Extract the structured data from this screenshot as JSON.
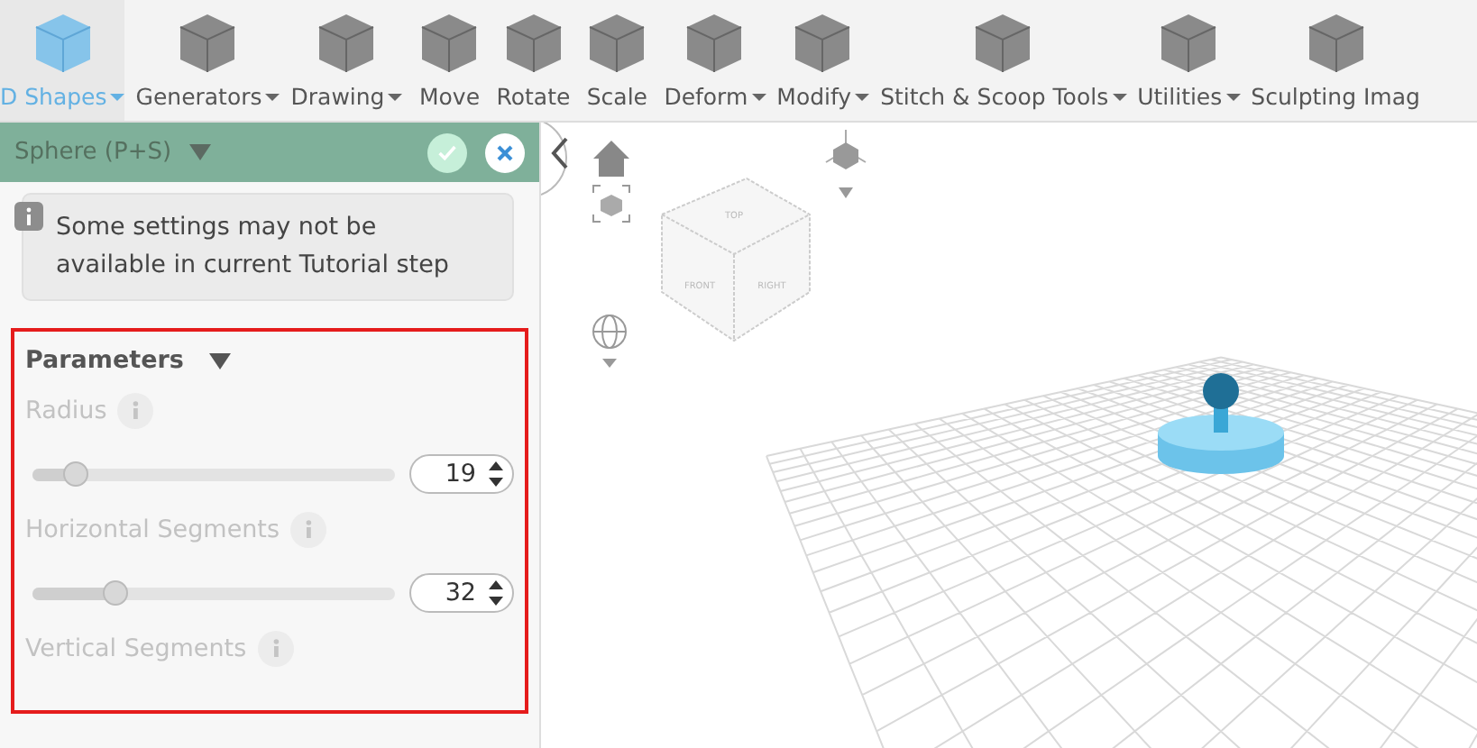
{
  "toolbar": {
    "items": [
      {
        "label": "D Shapes",
        "dropdown": true,
        "selected": true
      },
      {
        "label": "Generators",
        "dropdown": true,
        "selected": false
      },
      {
        "label": "Drawing",
        "dropdown": true,
        "selected": false
      },
      {
        "label": "Move",
        "dropdown": false,
        "selected": false
      },
      {
        "label": "Rotate",
        "dropdown": false,
        "selected": false
      },
      {
        "label": "Scale",
        "dropdown": false,
        "selected": false
      },
      {
        "label": "Deform",
        "dropdown": true,
        "selected": false
      },
      {
        "label": "Modify",
        "dropdown": true,
        "selected": false
      },
      {
        "label": "Stitch & Scoop Tools",
        "dropdown": true,
        "selected": false
      },
      {
        "label": "Utilities",
        "dropdown": true,
        "selected": false
      },
      {
        "label": "Sculpting Imag",
        "dropdown": false,
        "selected": false
      }
    ]
  },
  "panel": {
    "title": "Sphere (P+S)",
    "note": "Some settings may not be available in current Tutorial step",
    "section": {
      "title": "Parameters",
      "highlighted": true,
      "params": [
        {
          "label": "Radius",
          "disabled": true,
          "level": 0.12,
          "value": "19"
        },
        {
          "label": "Horizontal Segments",
          "disabled": true,
          "level": 0.23,
          "value": "32"
        },
        {
          "label": "Vertical Segments",
          "disabled": true
        }
      ]
    }
  },
  "viewport": {
    "view_cube": {
      "faces": [
        "TOP",
        "FRONT",
        "RIGHT"
      ]
    }
  }
}
